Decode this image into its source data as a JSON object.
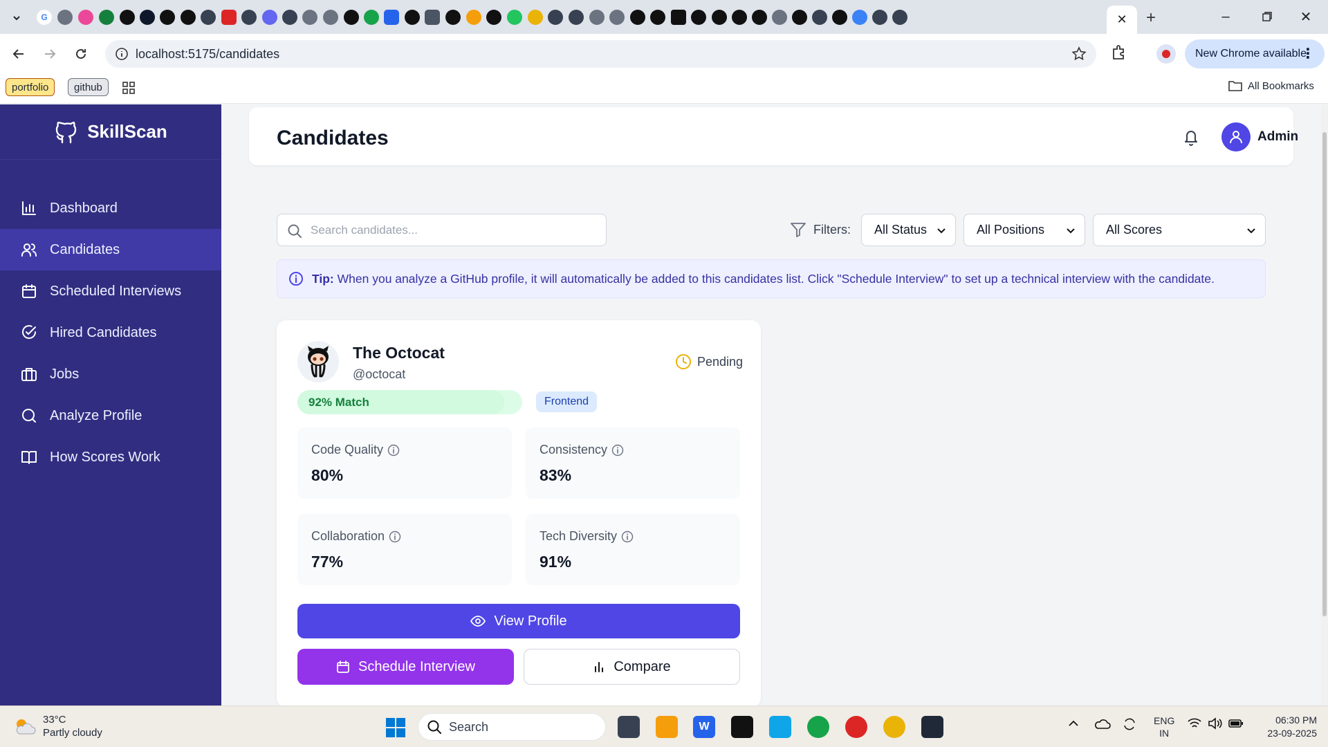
{
  "browser": {
    "url": "localhost:5175/candidates",
    "update_label": "New Chrome available",
    "bookmarks": [
      "portfolio",
      "github"
    ],
    "all_bookmarks_label": "All Bookmarks"
  },
  "sidebar": {
    "brand": "SkillScan",
    "items": [
      {
        "label": "Dashboard",
        "icon": "bar-chart-icon"
      },
      {
        "label": "Candidates",
        "icon": "users-icon",
        "active": true
      },
      {
        "label": "Scheduled Interviews",
        "icon": "calendar-icon"
      },
      {
        "label": "Hired Candidates",
        "icon": "check-circle-icon"
      },
      {
        "label": "Jobs",
        "icon": "briefcase-icon"
      },
      {
        "label": "Analyze Profile",
        "icon": "search-icon"
      },
      {
        "label": "How Scores Work",
        "icon": "book-icon"
      }
    ]
  },
  "header": {
    "title": "Candidates",
    "user": "Admin"
  },
  "search": {
    "placeholder": "Search candidates...",
    "value": ""
  },
  "filters": {
    "label": "Filters:",
    "status": "All Status",
    "positions": "All Positions",
    "scores": "All Scores"
  },
  "tip": {
    "prefix": "Tip:",
    "text": "When you analyze a GitHub profile, it will automatically be added to this candidates list. Click \"Schedule Interview\" to set up a technical interview with the candidate."
  },
  "candidate": {
    "name": "The Octocat",
    "handle": "@octocat",
    "status": "Pending",
    "match_label": "92% Match",
    "match_value": 0.92,
    "role": "Frontend",
    "metrics": [
      {
        "label": "Code Quality",
        "value": "80%"
      },
      {
        "label": "Consistency",
        "value": "83%"
      },
      {
        "label": "Collaboration",
        "value": "77%"
      },
      {
        "label": "Tech Diversity",
        "value": "91%"
      }
    ],
    "actions": {
      "view": "View Profile",
      "schedule": "Schedule Interview",
      "compare": "Compare"
    }
  },
  "taskbar": {
    "weather_temp": "33°C",
    "weather_desc": "Partly cloudy",
    "search_label": "Search",
    "lang_1": "ENG",
    "lang_2": "IN",
    "time": "06:30 PM",
    "date": "23-09-2025"
  },
  "colors": {
    "sidebar_bg": "#312e81",
    "primary": "#4f46e5",
    "schedule": "#9333ea",
    "match_bg": "#dcfce7"
  }
}
